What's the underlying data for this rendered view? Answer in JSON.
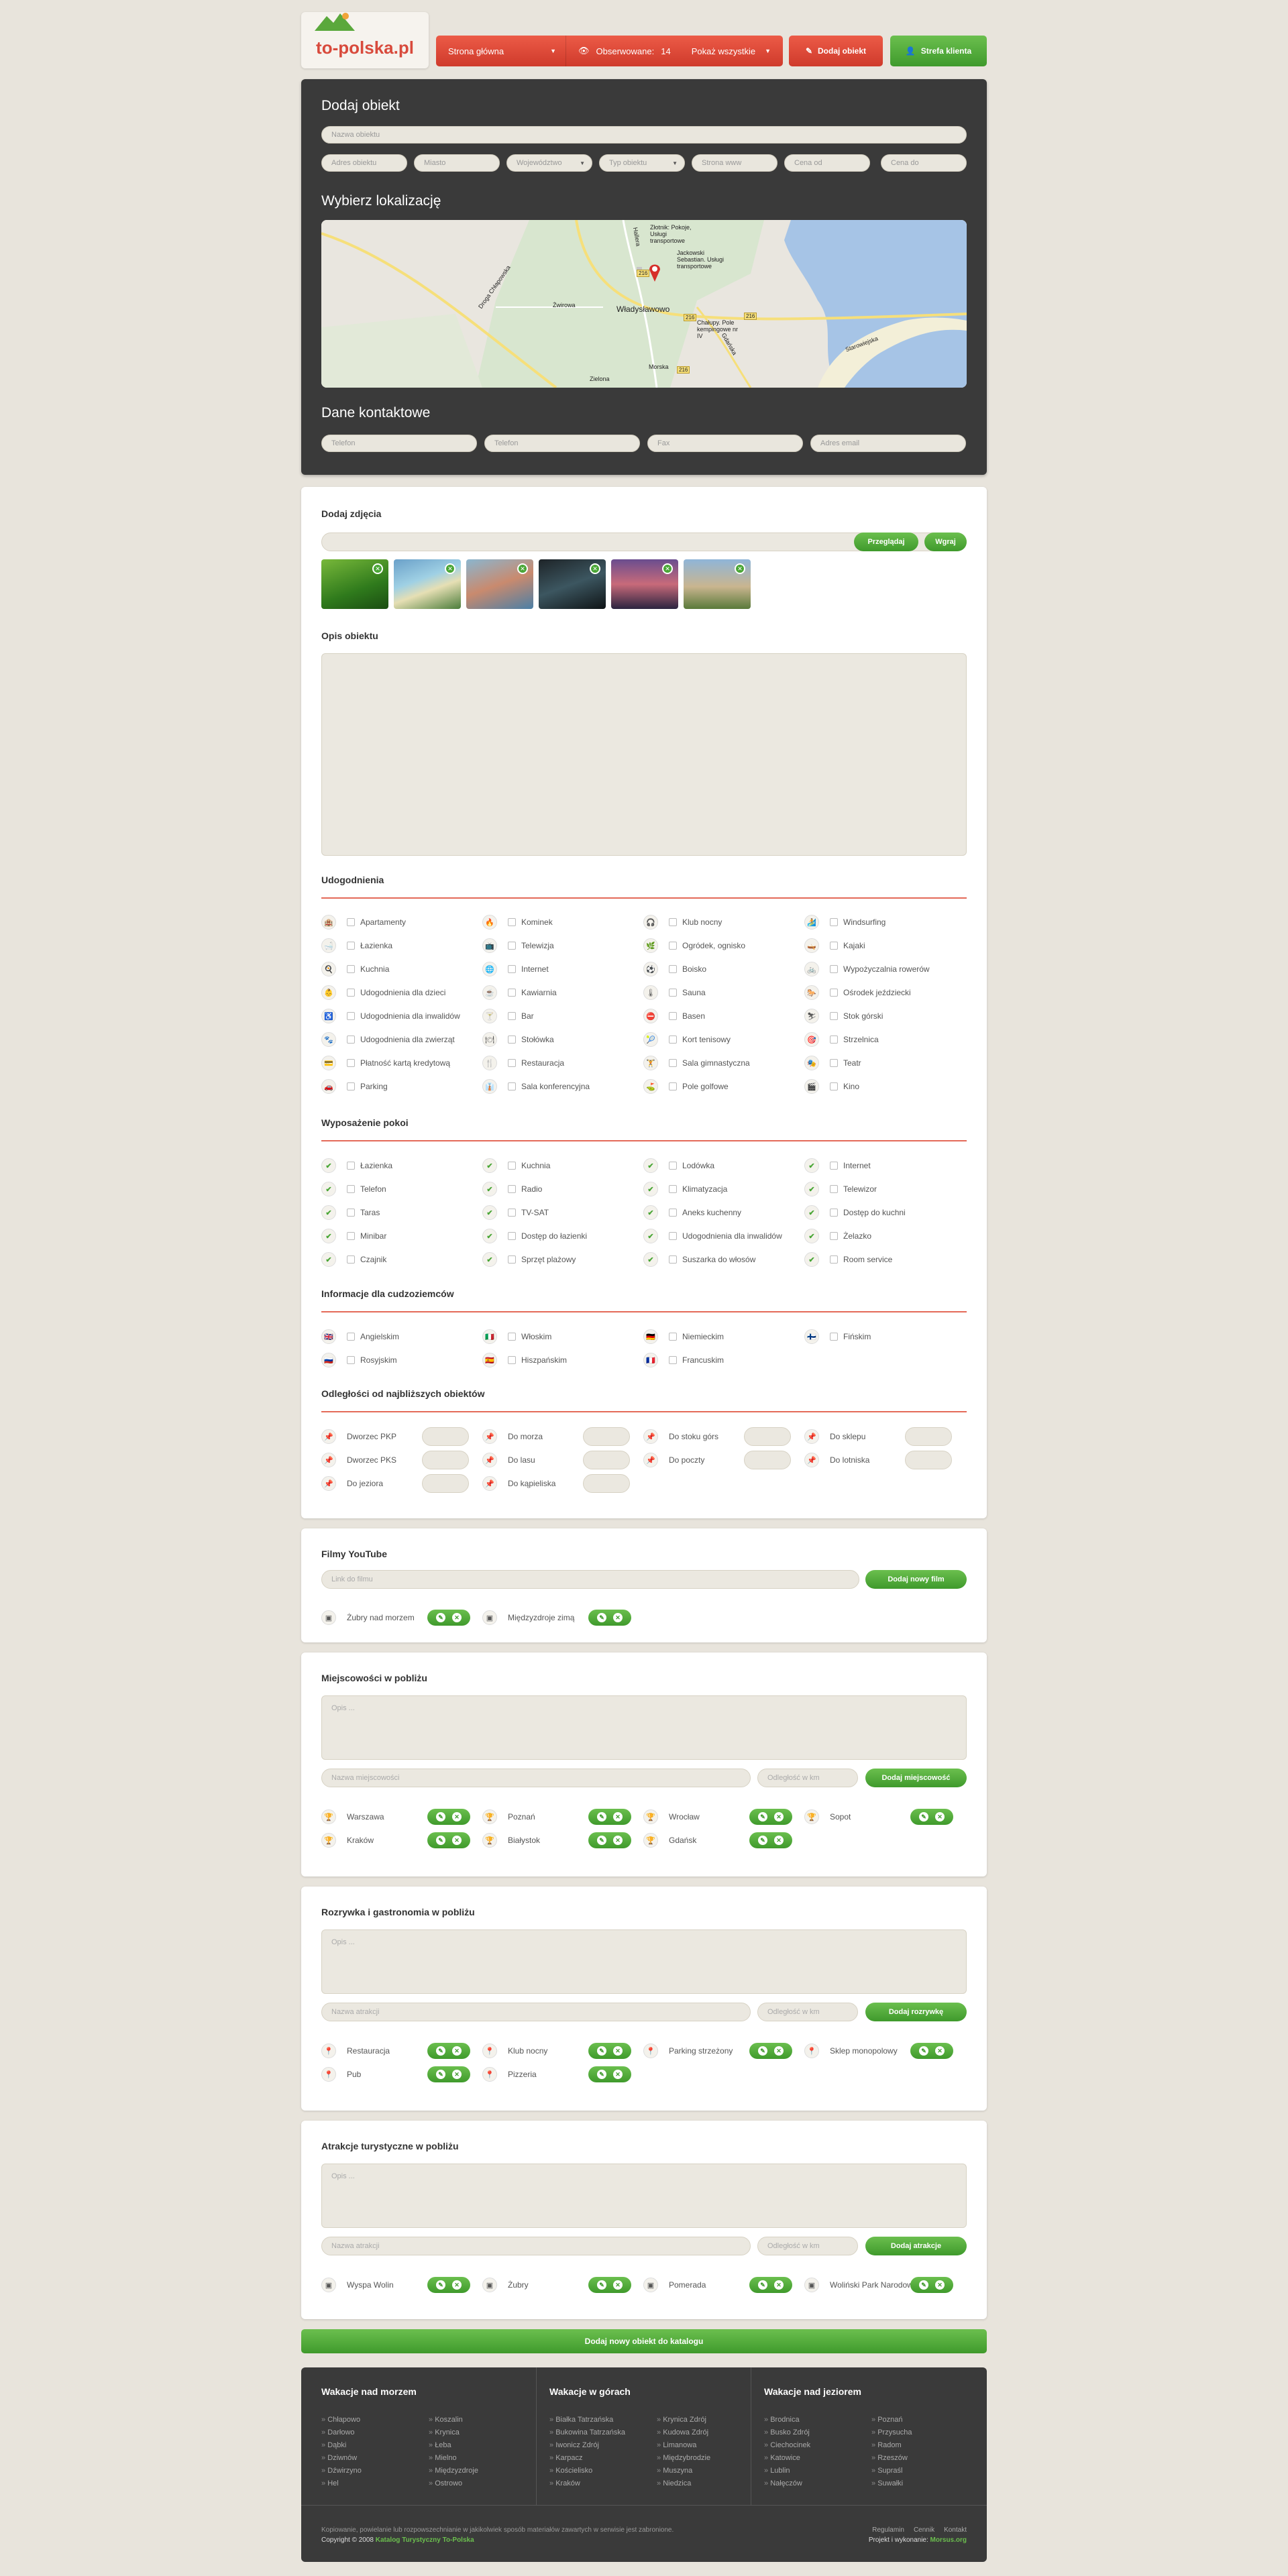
{
  "header": {
    "logo": "to-polska.pl",
    "nav": {
      "home": "Strona główna",
      "watched_label": "Obserwowane:",
      "watched_count": "14",
      "show_all": "Pokaż wszystkie"
    },
    "add_object": "Dodaj obiekt",
    "client_zone": "Strefa klienta"
  },
  "add": {
    "title": "Dodaj obiekt",
    "name_ph": "Nazwa obiektu",
    "fields": [
      "Adres obiektu",
      "Miasto",
      "Województwo",
      "Typ obiektu",
      "Strona www",
      "Cena od",
      "Cena do"
    ],
    "loc_title": "Wybierz lokalizację",
    "contact_title": "Dane kontaktowe",
    "contact": [
      "Telefon",
      "Telefon",
      "Fax",
      "Adres email"
    ]
  },
  "map": {
    "labels": [
      "Władysławowo",
      "Chałupy. Pole kempingowe nr IV",
      "Złotnik: Pokoje, Usługi transportowe",
      "Jackowski Sebastian. Usługi transportowe",
      "Żwirowa",
      "Droga Chłapowska",
      "Hallera",
      "Gdańska",
      "Zielona",
      "Morska",
      "Starowiejska",
      "216",
      "216",
      "216",
      "216"
    ]
  },
  "photos": {
    "title": "Dodaj zdjęcia",
    "browse": "Przeglądaj",
    "upload": "Wgraj"
  },
  "desc": {
    "title": "Opis obiektu"
  },
  "amen": {
    "title": "Udogodnienia",
    "cols": [
      [
        "Apartamenty",
        "Łazienka",
        "Kuchnia",
        "Udogodnienia dla dzieci",
        "Udogodnienia dla inwalidów",
        "Udogodnienia dla zwierząt",
        "Płatność kartą kredytową",
        "Parking"
      ],
      [
        "Kominek",
        "Telewizja",
        "Internet",
        "Kawiarnia",
        "Bar",
        "Stołówka",
        "Restauracja",
        "Sala konferencyjna"
      ],
      [
        "Klub nocny",
        "Ogródek, ognisko",
        "Boisko",
        "Sauna",
        "Basen",
        "Kort tenisowy",
        "Sala gimnastyczna",
        "Pole golfowe"
      ],
      [
        "Windsurfing",
        "Kajaki",
        "Wypożyczalnia rowerów",
        "Ośrodek jeździecki",
        "Stok górski",
        "Strzelnica",
        "Teatr",
        "Kino"
      ]
    ]
  },
  "room": {
    "title": "Wyposażenie pokoi",
    "cols": [
      [
        "Łazienka",
        "Telefon",
        "Taras",
        "Minibar",
        "Czajnik"
      ],
      [
        "Kuchnia",
        "Radio",
        "TV-SAT",
        "Dostęp do łazienki",
        "Sprzęt plażowy"
      ],
      [
        "Lodówka",
        "Klimatyzacja",
        "Aneks kuchenny",
        "Udogodnienia dla inwalidów",
        "Suszarka do włosów"
      ],
      [
        "Internet",
        "Telewizor",
        "Dostęp do kuchni",
        "Żelazko",
        "Room service"
      ]
    ]
  },
  "lang": {
    "title": "Informacje dla cudzoziemców",
    "cols": [
      [
        "Angielskim",
        "Rosyjskim"
      ],
      [
        "Włoskim",
        "Hiszpańskim"
      ],
      [
        "Niemieckim",
        "Francuskim"
      ],
      [
        "Fińskim"
      ]
    ]
  },
  "dist": {
    "title": "Odległości od najbliższych obiektów",
    "cols": [
      [
        "Dworzec PKP",
        "Dworzec PKS",
        "Do jeziora"
      ],
      [
        "Do morza",
        "Do lasu",
        "Do kąpieliska"
      ],
      [
        "Do stoku górs",
        "Do poczty"
      ],
      [
        "Do sklepu",
        "Do lotniska"
      ]
    ]
  },
  "yt": {
    "title": "Filmy YouTube",
    "ph": "Link do filmu",
    "btn": "Dodaj nowy film",
    "items": [
      "Żubry nad morzem",
      "Międzyzdroje zimą"
    ]
  },
  "towns": {
    "title": "Miejscowości w pobliżu",
    "desc_ph": "Opis ...",
    "name_ph": "Nazwa miejscowości",
    "dist_ph": "Odległość w km",
    "btn": "Dodaj miejscowość",
    "items": [
      "Warszawa",
      "Poznań",
      "Wrocław",
      "Sopot",
      "Kraków",
      "Białystok",
      "Gdańsk"
    ]
  },
  "fun": {
    "title": "Rozrywka i gastronomia w pobliżu",
    "desc_ph": "Opis ...",
    "name_ph": "Nazwa atrakcji",
    "dist_ph": "Odległość w km",
    "btn": "Dodaj rozrywkę",
    "items": [
      "Restauracja",
      "Klub nocny",
      "Parking strzeżony",
      "Sklep monopolowy",
      "Pub",
      "Pizzeria"
    ]
  },
  "attr": {
    "title": "Atrakcje turystyczne w pobliżu",
    "desc_ph": "Opis ...",
    "name_ph": "Nazwa atrakcji",
    "dist_ph": "Odległość w km",
    "btn": "Dodaj atrakcje",
    "items": [
      "Wyspa Wolin",
      "Żubry",
      "Pomerada",
      "Woliński Park Narodowy"
    ]
  },
  "submit": "Dodaj nowy obiekt do katalogu",
  "footer": {
    "cols": [
      {
        "title": "Wakacje nad morzem",
        "links": [
          "Chłapowo",
          "Koszalin",
          "Darłowo",
          "Krynica",
          "Dąbki",
          "Łeba",
          "Dziwnów",
          "Mielno",
          "Dźwirzyno",
          "Międzyzdroje",
          "Hel",
          "Ostrowo"
        ]
      },
      {
        "title": "Wakacje w górach",
        "links": [
          "Białka Tatrzańska",
          "Krynica Zdrój",
          "Bukowina Tatrzańska",
          "Kudowa Zdrój",
          "Iwonicz Zdrój",
          "Limanowa",
          "Karpacz",
          "Międzybrodzie",
          "Kościelisko",
          "Muszyna",
          "Kraków",
          "Niedzica"
        ]
      },
      {
        "title": "Wakacje nad jeziorem",
        "links": [
          "Brodnica",
          "Poznań",
          "Busko Zdrój",
          "Przysucha",
          "Ciechocinek",
          "Radom",
          "Katowice",
          "Rzeszów",
          "Lublin",
          "Supraśl",
          "Nałęczów",
          "Suwałki"
        ]
      }
    ],
    "legal": "Kopiowanie, powielanie lub rozpowszechnianie w jakikolwiek sposób materiałów zawartych w serwisie jest zabronione.",
    "copy": "Copyright © 2008",
    "copy_link": "Katalog Turystyczny To-Polska",
    "links": [
      "Regulamin",
      "Cennik",
      "Kontakt"
    ],
    "made": "Projekt i wykonanie:",
    "made_link": "Morsus.org"
  }
}
